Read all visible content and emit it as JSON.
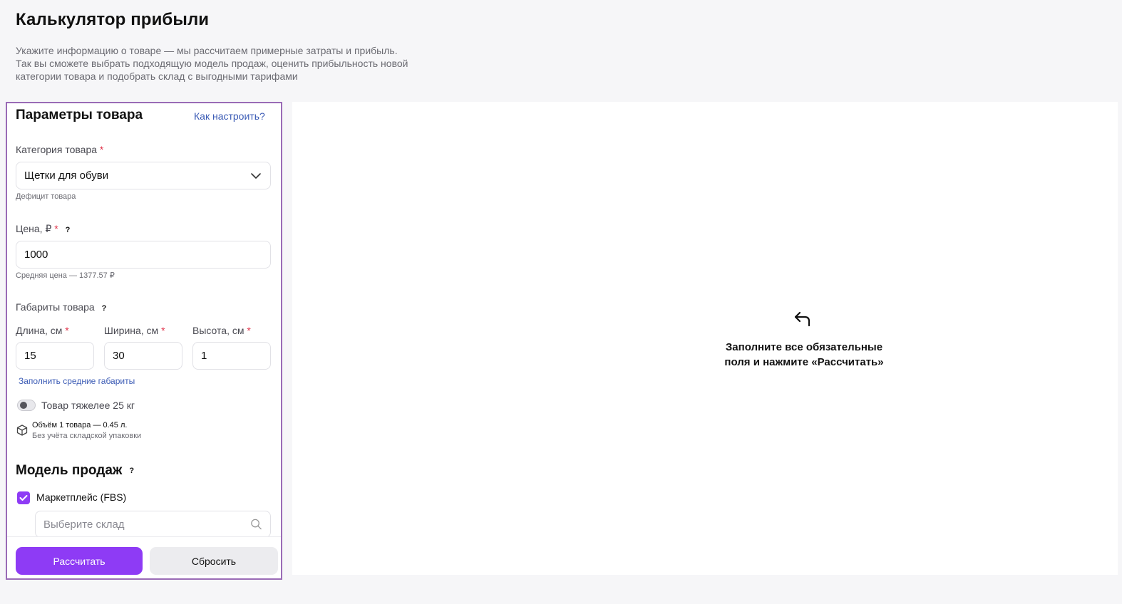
{
  "page": {
    "title": "Калькулятор прибыли",
    "description_lines": [
      "Укажите информацию о товаре — мы рассчитаем примерные затраты и прибыль.",
      "Так вы сможете выбрать подходящую модель продаж, оценить прибыльность новой",
      "категории товара и подобрать склад с выгодными тарифами"
    ]
  },
  "params": {
    "title": "Параметры товара",
    "how_to_link": "Как настроить?",
    "category": {
      "label": "Категория товара",
      "required_mark": "*",
      "value": "Щетки для обуви",
      "hint": "Дефицит товара"
    },
    "price": {
      "label": "Цена, ₽",
      "required_mark": "*",
      "help_mark": "?",
      "value": "1000",
      "hint": "Средняя цена — 1377.57 ₽"
    },
    "dimensions": {
      "label": "Габариты товара",
      "help_mark": "?",
      "length": {
        "label": "Длина, см",
        "required_mark": "*",
        "value": "15"
      },
      "width": {
        "label": "Ширина, см",
        "required_mark": "*",
        "value": "30"
      },
      "height": {
        "label": "Высота, см",
        "required_mark": "*",
        "value": "1"
      },
      "fill_avg_link": "Заполнить средние габариты"
    },
    "heavy_toggle": {
      "label": "Товар тяжелее 25 кг",
      "on": false
    },
    "volume": {
      "main": "Объём 1 товара — 0.45 л.",
      "sub": "Без учёта складской упаковки"
    },
    "sales_model": {
      "title": "Модель продаж",
      "help_mark": "?",
      "fbs": {
        "label": "Маркетплейс (FBS)",
        "checked": true
      },
      "warehouse_placeholder": "Выберите склад"
    }
  },
  "actions": {
    "calculate": "Рассчитать",
    "reset": "Сбросить"
  },
  "result": {
    "message_lines": [
      "Заполните все обязательные",
      "поля и нажмите «Рассчитать»"
    ]
  },
  "colors": {
    "accent": "#8e3bf5",
    "link": "#3b5bb5",
    "required": "#e0334a",
    "panel_border": "#9a6bb6",
    "background": "#f6f6f8"
  }
}
